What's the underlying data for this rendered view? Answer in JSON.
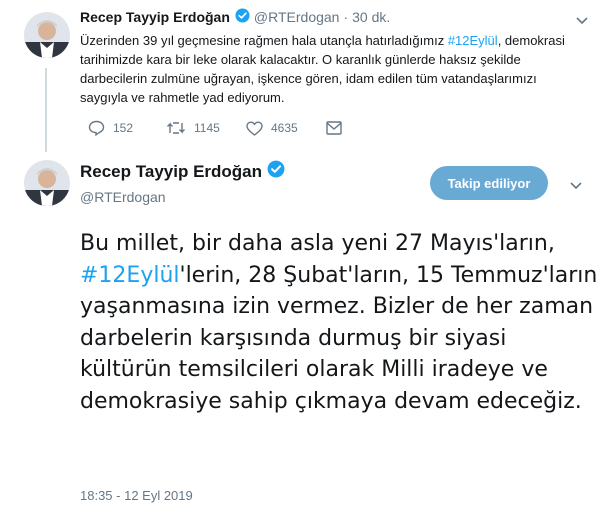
{
  "colors": {
    "accent": "#1da1f2",
    "follow_button": "#69aad5",
    "muted": "#657786",
    "text": "#14171a"
  },
  "tweet1": {
    "author_name": "Recep Tayyip Erdoğan",
    "handle": "@RTErdogan",
    "separator": "·",
    "time_ago": "30 dk.",
    "text_before": "Üzerinden 39 yıl geçmesine rağmen hala utançla hatırladığımız ",
    "hashtag": "#12Eylül",
    "text_after": ", demokrasi tarihimizde kara bir leke olarak kalacaktır. O karanlık günlerde haksız şekilde darbecilerin zulmüne uğrayan, işkence gören, idam edilen tüm vatandaşlarımızı saygıyla ve rahmetle yad ediyorum.",
    "reply_count": "152",
    "retweet_count": "1145",
    "like_count": "4635",
    "icons": [
      "reply-icon",
      "retweet-icon",
      "like-icon",
      "message-icon",
      "chevron-down-icon",
      "verified-badge-icon"
    ]
  },
  "tweet2": {
    "author_name": "Recep Tayyip Erdoğan",
    "handle": "@RTErdogan",
    "follow_label": "Takip ediliyor",
    "text_before": "Bu millet, bir daha asla yeni 27 Mayıs'ların, ",
    "hashtag": "#12Eylül",
    "text_after": "'lerin, 28 Şubat'ların, 15 Temmuz'ların yaşanmasına izin vermez. Bizler de her zaman darbelerin karşısında durmuş bir siyasi kültürün temsilcileri olarak Milli iradeye ve demokrasiye sahip çıkmaya devam edeceğiz.",
    "timestamp": "18:35 - 12 Eyl 2019"
  }
}
